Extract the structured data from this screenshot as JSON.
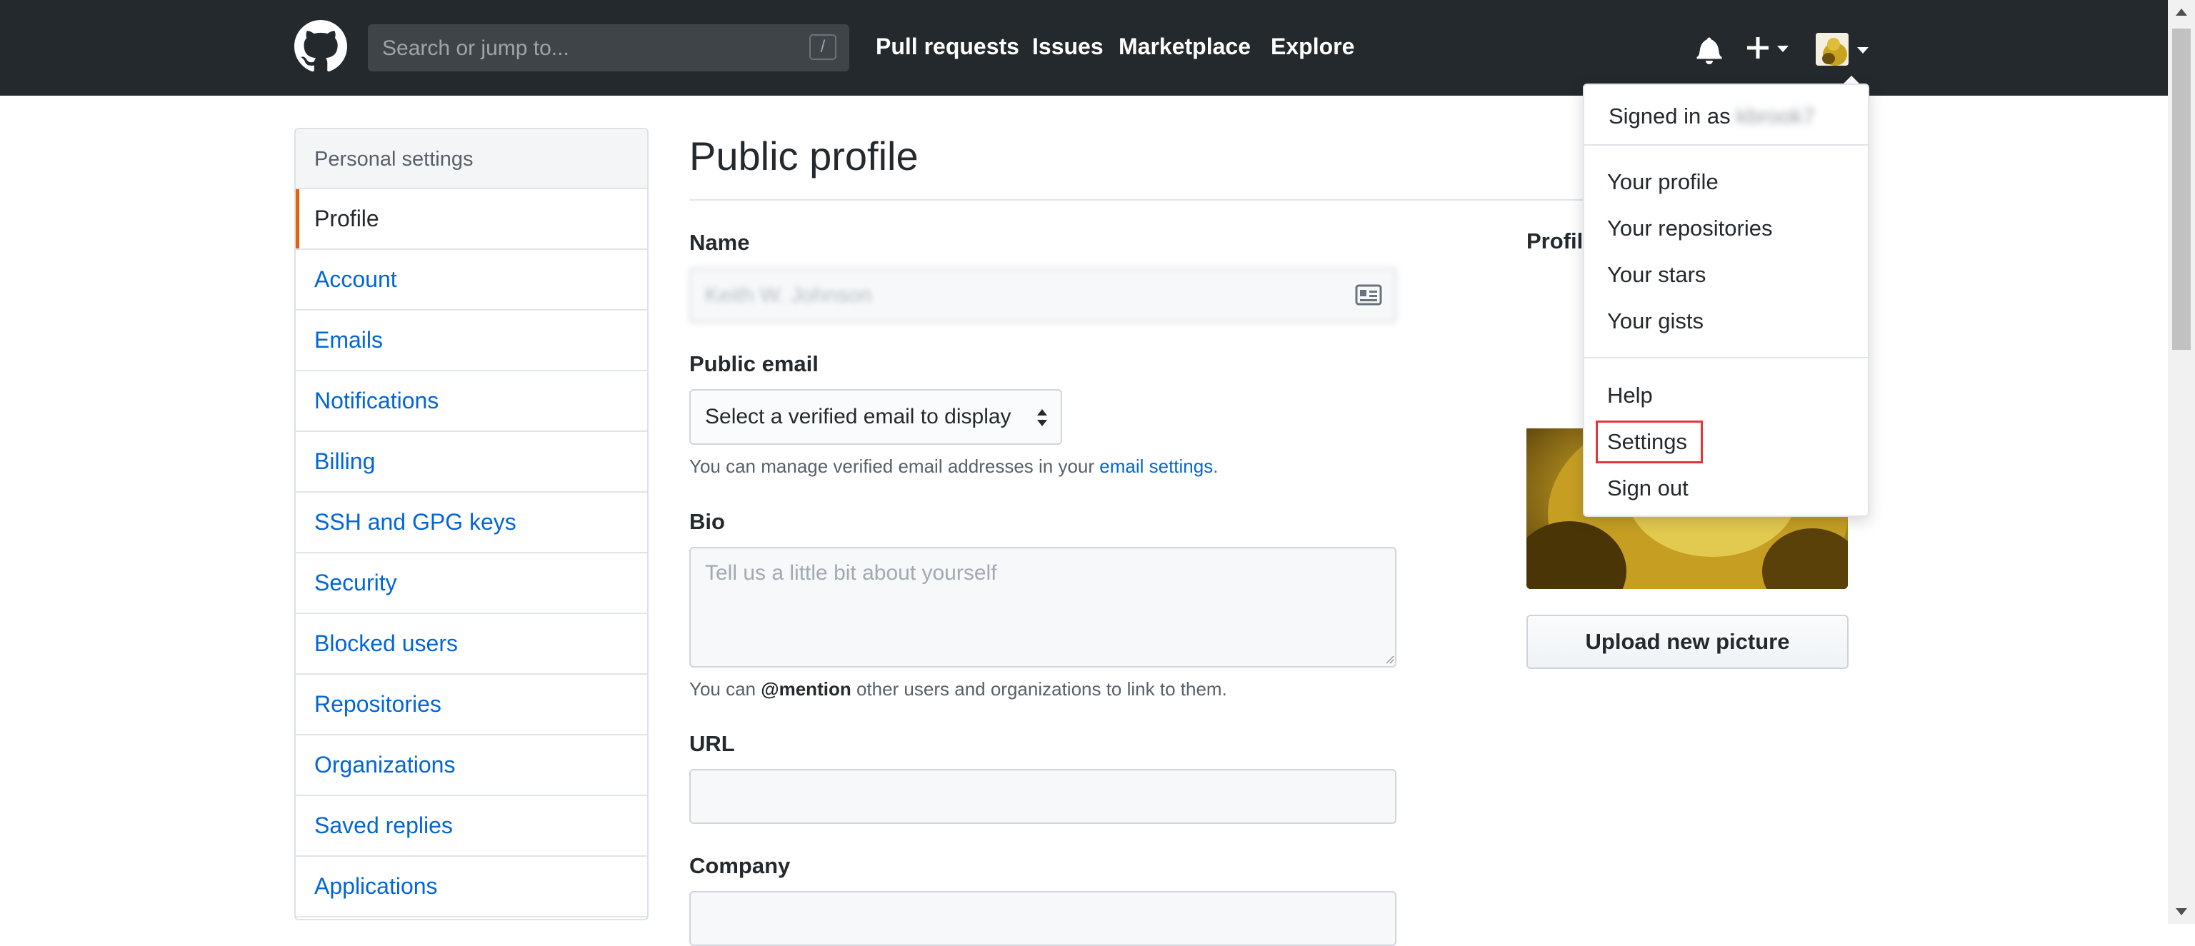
{
  "header": {
    "search_placeholder": "Search or jump to...",
    "search_shortcut": "/",
    "nav": [
      "Pull requests",
      "Issues",
      "Marketplace",
      "Explore"
    ]
  },
  "sidebar": {
    "heading": "Personal settings",
    "items": [
      {
        "label": "Profile",
        "selected": true
      },
      {
        "label": "Account"
      },
      {
        "label": "Emails"
      },
      {
        "label": "Notifications"
      },
      {
        "label": "Billing"
      },
      {
        "label": "SSH and GPG keys"
      },
      {
        "label": "Security"
      },
      {
        "label": "Blocked users"
      },
      {
        "label": "Repositories"
      },
      {
        "label": "Organizations"
      },
      {
        "label": "Saved replies"
      },
      {
        "label": "Applications"
      }
    ]
  },
  "main": {
    "title": "Public profile",
    "name_label": "Name",
    "name_value": "Keith W. Johnson",
    "public_email_label": "Public email",
    "public_email_selected": "Select a verified email to display",
    "email_note_text": "You can manage verified email addresses in your ",
    "email_note_link": "email settings",
    "email_note_end": ".",
    "bio_label": "Bio",
    "bio_placeholder": "Tell us a little bit about yourself",
    "bio_note_prefix": "You can ",
    "bio_note_mention": "@mention",
    "bio_note_suffix": " other users and organizations to link to them.",
    "url_label": "URL",
    "company_label": "Company",
    "profile_picture_label": "Profile picture",
    "upload_button": "Upload new picture"
  },
  "dropdown": {
    "signed_in_as": "Signed in as",
    "username": "kbrook7",
    "group1": [
      "Your profile",
      "Your repositories",
      "Your stars",
      "Your gists"
    ],
    "group2": [
      "Help",
      "Settings",
      "Sign out"
    ],
    "highlighted_item": "Settings"
  },
  "colors": {
    "header_bg": "#24292e",
    "link": "#0366d6",
    "selected_accent": "#e36209",
    "highlight_box": "#e0363c"
  }
}
